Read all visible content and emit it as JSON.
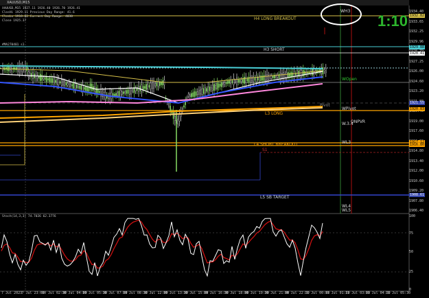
{
  "window": {
    "title": "XAUUSD,M15",
    "buttons": [
      "–",
      "□",
      "×"
    ]
  },
  "info_lines": [
    "XAUUSD,M15  1927.11 1926.40 1926.70 1926.41",
    "ClosHi 1929.11   Previous Day Range: 41.6",
    "ClosLo 1918.02   Current Day Range: 4030",
    "Close 1925.37"
  ],
  "indicator_label": "#MA270401 s1",
  "ratio_text": "1:10",
  "level_labels": [
    {
      "text": "H4 LONG BREAKOUT",
      "color": "#d8c24a"
    },
    {
      "text": "H3 SHORT",
      "color": "#cfd8e0"
    },
    {
      "text": "L3 LONG",
      "color": "#ffa500"
    },
    {
      "text": "L4 SHORT BREAKOUT",
      "color": "#ffa500"
    },
    {
      "text": "S1",
      "color": "#cc3333"
    },
    {
      "text": "L5 SB TARGET",
      "color": "#cfd8e0"
    },
    {
      "text": "Pivot",
      "color": "#888888"
    }
  ],
  "weekly_labels": [
    {
      "text": "WH3",
      "color": "#dddddd"
    },
    {
      "text": "WOpen",
      "color": "#33cc33"
    },
    {
      "text": "WPivot",
      "color": "#dddddd"
    },
    {
      "text": "WL3",
      "color": "#dddddd"
    },
    {
      "text": "WL4",
      "color": "#dddddd"
    },
    {
      "text": "WL5",
      "color": "#dddddd"
    },
    {
      "text": "W.3.4",
      "color": "#dddddd"
    },
    {
      "text": "ONPVR",
      "color": "#dddddd"
    }
  ],
  "price_axis": [
    "1934.40",
    "1933.65",
    "1932.25",
    "1929.96",
    "1928.79",
    "1927.25",
    "1926.00",
    "1924.60",
    "1923.20",
    "1921.80",
    "1920.40",
    "1919.00",
    "1917.60",
    "1916.20",
    "1914.80",
    "1913.40",
    "1912.00",
    "1910.60",
    "1909.20",
    "1907.80",
    "1906.40"
  ],
  "price_tags": [
    {
      "text": "1932.82",
      "bg": "#d8c24a",
      "fg": "#000"
    },
    {
      "text": "1929.88",
      "bg": "#4ad0d8",
      "fg": "#000"
    },
    {
      "text": "1928.41",
      "bg": "#ffffff",
      "fg": "#000"
    },
    {
      "text": "1921.55",
      "bg": "#3344aa",
      "fg": "#fff"
    },
    {
      "text": "1920.83",
      "bg": "#ffa500",
      "fg": "#000"
    },
    {
      "text": "1917.12",
      "bg": "#ffa500",
      "fg": "#000"
    },
    {
      "text": "1916.80",
      "bg": "#ffa500",
      "fg": "#000"
    },
    {
      "text": "1908.61",
      "bg": "#3344aa",
      "fg": "#fff"
    }
  ],
  "osc_label": "Stoch(14,3,3) 74.7026 62.3776",
  "osc_axis": [
    "100",
    "75",
    "50",
    "25",
    "0"
  ],
  "x_axis": [
    "7 Jul 2023",
    "7 Jul 23:00",
    "10 Jul 02:30",
    "10 Jul 04:00",
    "10 Jul 05:30",
    "10 Jul 07:00",
    "10 Jul 08:30",
    "10 Jul 12:00",
    "10 Jul 13:30",
    "10 Jul 15:00",
    "10 Jul 16:30",
    "10 Jul 18:00",
    "10 Jul 19:30",
    "10 Jul 21:00",
    "10 Jul 22:30",
    "11 Jul 00:00",
    "11 Jul 01:30",
    "11 Jul 03:00",
    "11 Jul 04:30",
    "11 Jul 05:30"
  ],
  "colors": {
    "bull_candle": "#88dd66",
    "bear_candle": "#dddddd",
    "h4": "#d8c24a",
    "h3": "#4ad0d8",
    "l3": "#ffa500",
    "l5": "#3344aa",
    "stoch_main": "#ffffff",
    "stoch_signal": "#cc1111"
  }
}
